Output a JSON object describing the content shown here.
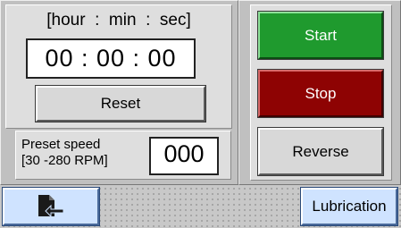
{
  "timer": {
    "caption": "[hour  :  min  :  sec]",
    "value": "00 : 00 : 00"
  },
  "buttons": {
    "reset": "Reset",
    "start": "Start",
    "stop": "Stop",
    "reverse": "Reverse",
    "lubrication": "Lubrication"
  },
  "preset": {
    "label": "Preset speed\n[30 -280 RPM]",
    "value": "000"
  },
  "icons": {
    "exit": "exit-icon"
  },
  "colors": {
    "start": "#1f9a2e",
    "stop": "#8e0303",
    "lubrication": "#cfe3ff"
  }
}
